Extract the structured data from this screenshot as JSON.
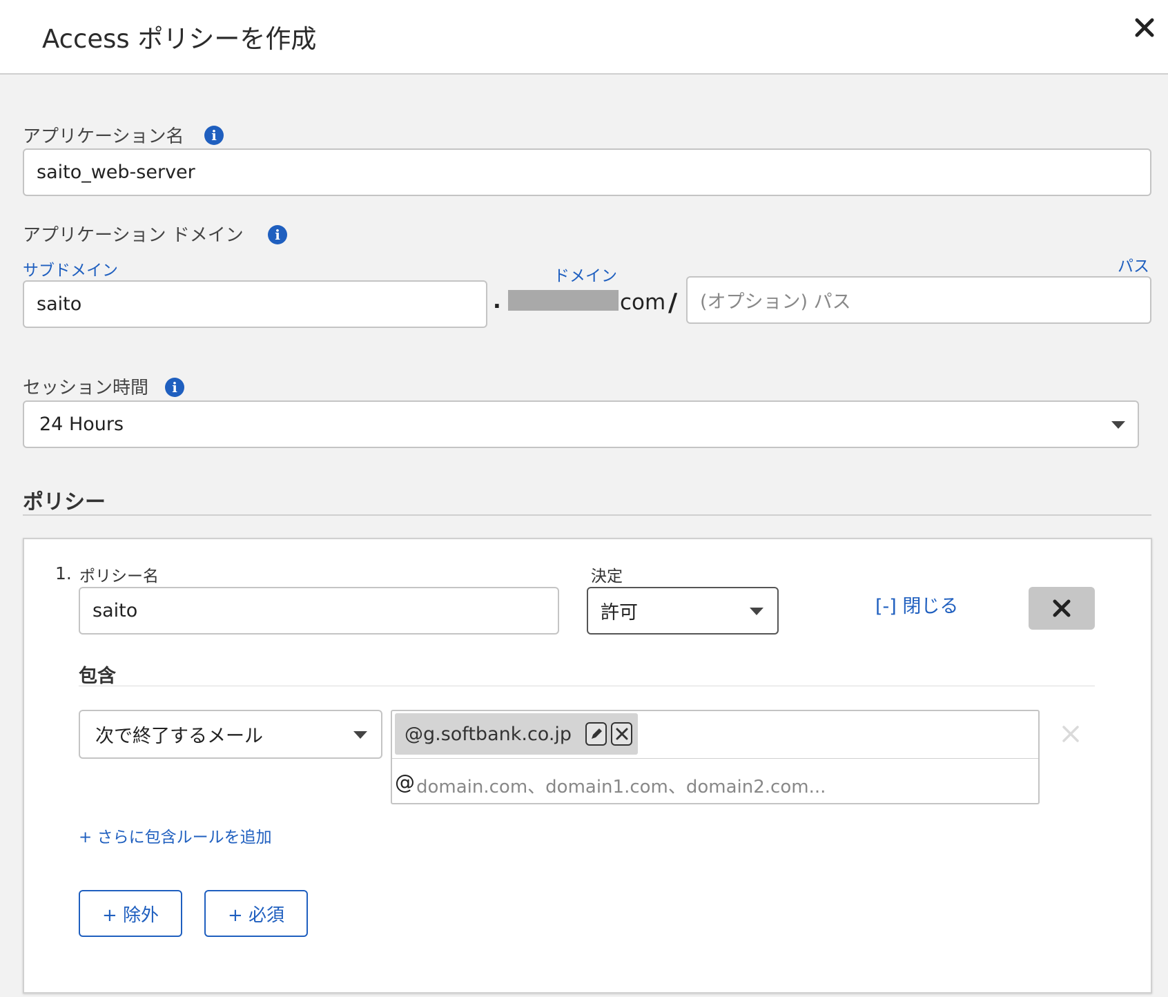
{
  "dialog": {
    "title": "Access ポリシーを作成",
    "close_icon": "close-icon"
  },
  "app_name": {
    "label": "アプリケーション名",
    "value": "saito_web-server"
  },
  "app_domain": {
    "label": "アプリケーション ドメイン",
    "subdomain_label": "サブドメイン",
    "subdomain_value": "saito",
    "dot": ".",
    "domain_label": "ドメイン",
    "domain_suffix": "com",
    "slash": "/",
    "path_label": "パス",
    "path_placeholder": "(オプション) パス"
  },
  "session": {
    "label": "セッション時間",
    "value": "24 Hours"
  },
  "policy_section": {
    "title": "ポリシー"
  },
  "policy": {
    "number": "1.",
    "name_label": "ポリシー名",
    "name_value": "saito",
    "decision_label": "決定",
    "decision_value": "許可",
    "collapse_label": "[-] 閉じる",
    "include_title": "包含",
    "rule_selector": "次で終了するメール",
    "tag_value": "@g.softbank.co.jp",
    "at_symbol": "@",
    "domain_placeholder": "domain.com、domain1.com、domain2.com...",
    "add_include_rule": "+ さらに包含ルールを追加",
    "exclude_button": "+ 除外",
    "require_button": "+ 必須"
  },
  "colors": {
    "accent": "#1f5fbf",
    "background": "#f2f2f2",
    "redaction": "#a9a9a9"
  }
}
